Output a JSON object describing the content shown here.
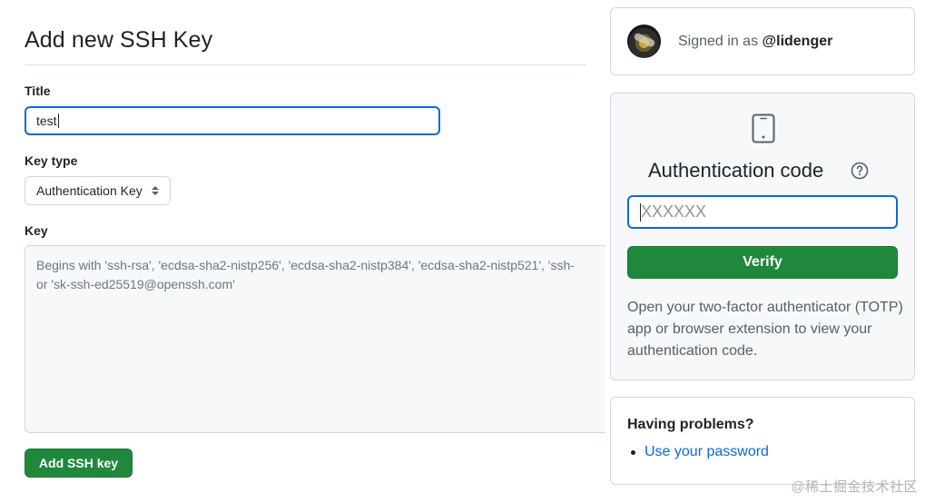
{
  "form": {
    "title": "Add new SSH Key",
    "title_label": "Title",
    "title_value": "test",
    "key_type_label": "Key type",
    "key_type_value": "Authentication Key",
    "key_label": "Key",
    "key_placeholder_line1": "Begins with 'ssh-rsa', 'ecdsa-sha2-nistp256', 'ecdsa-sha2-nistp384', 'ecdsa-sha2-nistp521', 'ssh-",
    "key_placeholder_line2": "or 'sk-ssh-ed25519@openssh.com'",
    "submit_label": "Add SSH key"
  },
  "session": {
    "signed_in_prefix": "Signed in as",
    "username": "@lidenger"
  },
  "auth": {
    "title": "Authentication code",
    "code_placeholder": "XXXXXX",
    "verify_label": "Verify",
    "description": "Open your two-factor authenticator (TOTP) app or browser extension to view your authentication code."
  },
  "problems": {
    "title": "Having problems?",
    "links": [
      {
        "label": "Use your password"
      }
    ]
  },
  "watermark": "@稀土掘金技术社区",
  "colors": {
    "primary_button": "#1f883d",
    "focus_border": "#0969da",
    "link": "#0969da",
    "muted_panel": "#f6f8fa"
  },
  "icons": {
    "device": "device-mobile-icon",
    "help": "question-icon",
    "select": "select-arrows-icon"
  }
}
